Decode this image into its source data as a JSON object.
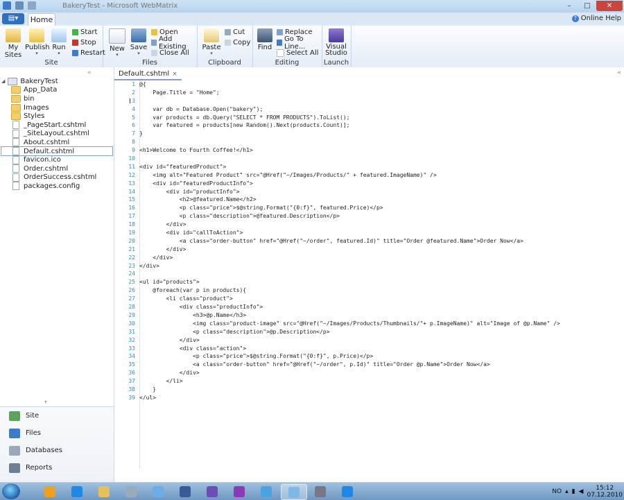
{
  "window": {
    "title": "BakeryTest - Microsoft WebMatrix"
  },
  "window_controls": {
    "minimize": "–",
    "maximize": "□",
    "close": "✕"
  },
  "tabs": {
    "file_label": "▤▾",
    "home_label": "Home"
  },
  "help": {
    "label": "Online Help"
  },
  "ribbon": {
    "site": {
      "label": "Site",
      "my_sites": "My Sites",
      "publish": "Publish",
      "run": "Run",
      "start": "Start",
      "stop": "Stop",
      "restart": "Restart"
    },
    "files": {
      "label": "Files",
      "new": "New",
      "save": "Save",
      "open": "Open",
      "add_existing": "Add Existing",
      "close_all": "Close All"
    },
    "clipboard": {
      "label": "Clipboard",
      "paste": "Paste",
      "cut": "Cut",
      "copy": "Copy"
    },
    "editing": {
      "label": "Editing",
      "find": "Find",
      "replace": "Replace",
      "go_to_line": "Go To Line...",
      "select_all": "Select All"
    },
    "launch": {
      "label": "Launch",
      "visual_studio": "Visual Studio"
    }
  },
  "tree": {
    "root": "BakeryTest",
    "items": [
      {
        "label": "App_Data",
        "kind": "folder"
      },
      {
        "label": "bin",
        "kind": "folder"
      },
      {
        "label": "Images",
        "kind": "folder"
      },
      {
        "label": "Styles",
        "kind": "folder"
      },
      {
        "label": "_PageStart.cshtml",
        "kind": "file"
      },
      {
        "label": "_SiteLayout.cshtml",
        "kind": "file"
      },
      {
        "label": "About.cshtml",
        "kind": "file"
      },
      {
        "label": "Default.cshtml",
        "kind": "file",
        "selected": true
      },
      {
        "label": "favicon.ico",
        "kind": "file"
      },
      {
        "label": "Order.cshtml",
        "kind": "file"
      },
      {
        "label": "OrderSuccess.cshtml",
        "kind": "file"
      },
      {
        "label": "packages.config",
        "kind": "file"
      }
    ]
  },
  "workspaces": [
    {
      "label": "Site",
      "icon": "globe-icon",
      "color": "#5aa35a"
    },
    {
      "label": "Files",
      "icon": "files-icon",
      "color": "#3d7cc9"
    },
    {
      "label": "Databases",
      "icon": "database-icon",
      "color": "#9aa9b9"
    },
    {
      "label": "Reports",
      "icon": "reports-icon",
      "color": "#6d7f93"
    }
  ],
  "editor": {
    "tab": "Default.cshtml",
    "tab_close": "×",
    "panel_collapse": "«",
    "sidebar_collapse": "«",
    "lines": [
      "@{",
      "    Page.Title = \"Home\";",
      "",
      "    var db = Database.Open(\"bakery\");",
      "    var products = db.Query(\"SELECT * FROM PRODUCTS\").ToList();",
      "    var featured = products[new Random().Next(products.Count)];",
      "}",
      "",
      "<h1>Welcome to Fourth Coffee!</h1>",
      "",
      "<div id=\"featuredProduct\">",
      "    <img alt=\"Featured Product\" src=\"@Href(\"~/Images/Products/\" + featured.ImageName)\" />",
      "    <div id=\"featuredProductInfo\">",
      "        <div id=\"productInfo\">",
      "            <h2>@featured.Name</h2>",
      "            <p class=\"price\">$@string.Format(\"{0:f}\", featured.Price)</p>",
      "            <p class=\"description\">@featured.Description</p>",
      "        </div>",
      "        <div id=\"callToAction\">",
      "            <a class=\"order-button\" href=\"@Href(\"~/order\", featured.Id)\" title=\"Order @featured.Name\">Order Now</a>",
      "        </div>",
      "    </div>",
      "</div>",
      "",
      "<ul id=\"products\">",
      "    @foreach(var p in products){",
      "        <li class=\"product\">",
      "            <div class=\"productInfo\">",
      "                <h3>@p.Name</h3>",
      "                <img class=\"product-image\" src=\"@Href(\"~/Images/Products/Thumbnails/\"+ p.ImageName)\" alt=\"Image of @p.Name\" />",
      "                <p class=\"description\">@p.Description</p>",
      "            </div>",
      "            <div class=\"action\">",
      "                <p class=\"price\">$@string.Format(\"{0:f}\", p.Price)</p>",
      "                <a class=\"order-button\" href=\"@Href(\"~/order\", p.Id)\" title=\"Order @p.Name\">Order Now</a>",
      "            </div>",
      "        </li>",
      "    }",
      "</ul>"
    ]
  },
  "taskbar": {
    "apps": [
      {
        "icon": "outlook-icon",
        "color": "#f0a020"
      },
      {
        "icon": "ie-icon",
        "color": "#1e88e5"
      },
      {
        "icon": "explorer-icon",
        "color": "#e6c15a"
      },
      {
        "icon": "tool-icon",
        "color": "#9ab"
      },
      {
        "icon": "bird-icon",
        "color": "#6aaee8"
      },
      {
        "icon": "facebook-icon",
        "color": "#3b5998"
      },
      {
        "icon": "visualstudio-icon",
        "color": "#6a4fb5"
      },
      {
        "icon": "onenote-icon",
        "color": "#8a3ab9"
      },
      {
        "icon": "sharepoint-icon",
        "color": "#4aa3df"
      },
      {
        "icon": "webmatrix-icon",
        "color": "#7fb8e6",
        "active": true
      },
      {
        "icon": "tools-icon",
        "color": "#778"
      },
      {
        "icon": "ie-icon",
        "color": "#1e88e5"
      }
    ],
    "language": "NO",
    "time": "15:12",
    "date": "07.12.2010"
  }
}
